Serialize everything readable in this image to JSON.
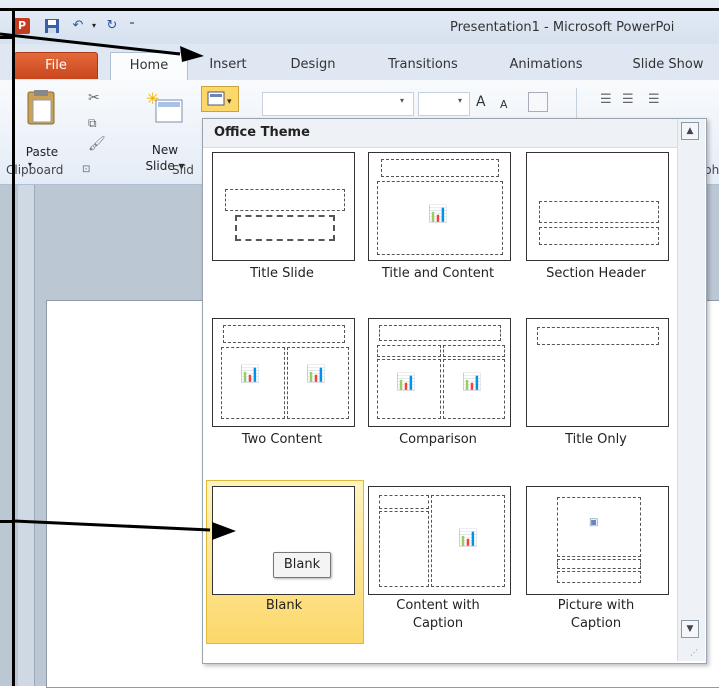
{
  "window": {
    "title": "Presentation1  -  Microsoft PowerPoi"
  },
  "quick_access": {
    "app_icon": "P",
    "save_icon": "save-icon",
    "undo_icon": "undo-icon",
    "redo_icon": "redo-icon",
    "customize_icon": "customize-icon"
  },
  "tabs": [
    {
      "label": "File"
    },
    {
      "label": "Home"
    },
    {
      "label": "Insert"
    },
    {
      "label": "Design"
    },
    {
      "label": "Transitions"
    },
    {
      "label": "Animations"
    },
    {
      "label": "Slide Show"
    }
  ],
  "ribbon": {
    "paste_label": "Paste",
    "new_slide_label_1": "New",
    "new_slide_label_2": "Slide ▾",
    "clipboard_group": "Clipboard",
    "slides_group": "Slid",
    "paragraph_group_fragment": "ph",
    "font_size_grow": "A",
    "font_size_shrink": "A"
  },
  "gallery": {
    "header": "Office Theme",
    "layouts": [
      {
        "label": "Title Slide"
      },
      {
        "label": "Title and Content"
      },
      {
        "label": "Section Header"
      },
      {
        "label": "Two Content"
      },
      {
        "label": "Comparison"
      },
      {
        "label": "Title Only"
      },
      {
        "label": "Blank"
      },
      {
        "label_1": "Content with",
        "label_2": "Caption"
      },
      {
        "label_1": "Picture with",
        "label_2": "Caption"
      }
    ],
    "tooltip": "Blank",
    "selected": "Blank"
  },
  "colors": {
    "file_tab": "#c8461d",
    "selection": "#fcd86a",
    "ribbon": "#e4ecf6"
  }
}
